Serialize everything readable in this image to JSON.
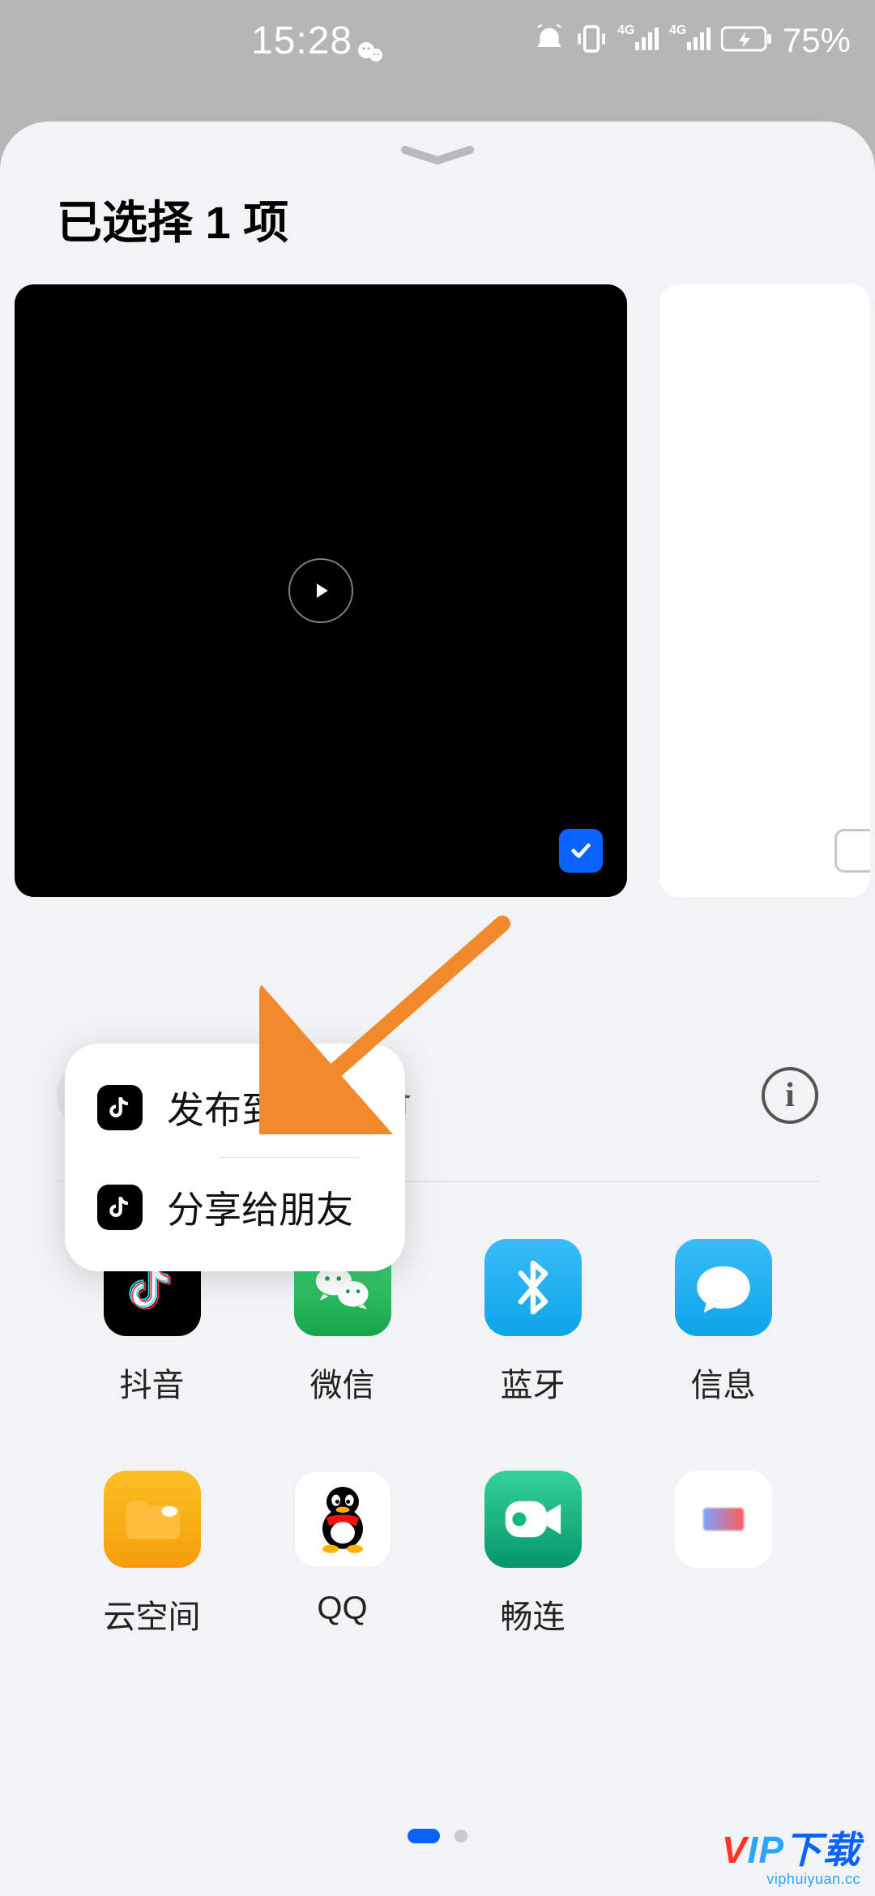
{
  "status": {
    "time": "15:28",
    "battery_text": "75%"
  },
  "sheet": {
    "title": "已选择 1 项"
  },
  "nearby": {
    "label": "分享到附近设备"
  },
  "popup": {
    "items": [
      {
        "label": "发布到抖音"
      },
      {
        "label": "分享给朋友"
      }
    ]
  },
  "apps_row1": [
    {
      "label": "抖音"
    },
    {
      "label": "微信"
    },
    {
      "label": "蓝牙"
    },
    {
      "label": "信息"
    }
  ],
  "apps_row2": [
    {
      "label": "云空间"
    },
    {
      "label": "QQ"
    },
    {
      "label": "畅连"
    },
    {
      "label": ""
    }
  ],
  "watermark": {
    "main_rest": "下载",
    "sub": "viphuiyuan.cc"
  }
}
